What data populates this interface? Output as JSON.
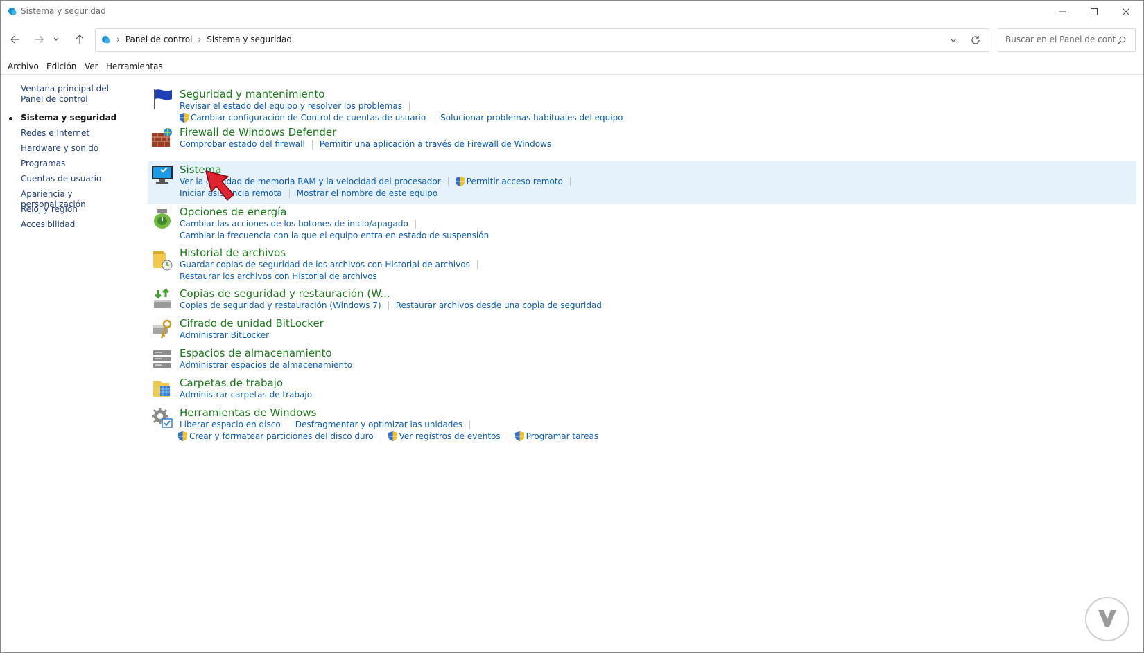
{
  "window": {
    "title": "Sistema y seguridad",
    "controls": [
      "minimize-icon",
      "maximize-icon",
      "close-icon"
    ]
  },
  "address_bar": {
    "breadcrumb": [
      "Panel de control",
      "Sistema y seguridad"
    ],
    "search_placeholder": "Buscar en el Panel de control"
  },
  "menu": [
    "Archivo",
    "Edición",
    "Ver",
    "Herramientas"
  ],
  "sidebar": {
    "items": [
      {
        "label": "Ventana principal del Panel de control",
        "active": false
      },
      {
        "label": "Sistema y seguridad",
        "active": true
      },
      {
        "label": "Redes e Internet",
        "active": false
      },
      {
        "label": "Hardware y sonido",
        "active": false
      },
      {
        "label": "Programas",
        "active": false
      },
      {
        "label": "Cuentas de usuario",
        "active": false
      },
      {
        "label": "Apariencia y personalización",
        "active": false
      },
      {
        "label": "Reloj y región",
        "active": false
      },
      {
        "label": "Accesibilidad",
        "active": false
      }
    ]
  },
  "categories": [
    {
      "title": "Seguridad y mantenimiento",
      "icon": "flag-icon",
      "rows": [
        [
          "Revisar el estado del equipo y resolver los problemas"
        ],
        [
          "Cambiar configuración de Control de cuentas de usuario",
          "Solucionar problemas habituales del equipo"
        ]
      ]
    },
    {
      "title": "Firewall de Windows Defender",
      "icon": "firewall-icon",
      "rows": [
        [
          "Comprobar estado del firewall",
          "Permitir una aplicación a través de Firewall de Windows"
        ]
      ]
    },
    {
      "title": "Sistema",
      "icon": "monitor-icon",
      "highlighted": true,
      "rows": [
        [
          "Ver la cantidad de memoria RAM y la velocidad del procesador",
          "Permitir acceso remoto"
        ],
        [
          "Iniciar asistencia remota",
          "Mostrar el nombre de este equipo"
        ]
      ]
    },
    {
      "title": "Opciones de energía",
      "icon": "battery-icon",
      "rows": [
        [
          "Cambiar las acciones de los botones de inicio/apagado"
        ],
        [
          "Cambiar la frecuencia con la que el equipo entra en estado de suspensión"
        ]
      ]
    },
    {
      "title": "Historial de archivos",
      "icon": "file-history-icon",
      "rows": [
        [
          "Guardar copias de seguridad de los archivos con Historial de archivos"
        ],
        [
          "Restaurar los archivos con Historial de archivos"
        ]
      ]
    },
    {
      "title": "Copias de seguridad y restauración (W...",
      "icon": "backup-icon",
      "rows": [
        [
          "Copias de seguridad y restauración (Windows 7)",
          "Restaurar archivos desde una copia de seguridad"
        ]
      ]
    },
    {
      "title": "Cifrado de unidad BitLocker",
      "icon": "bitlocker-icon",
      "rows": [
        [
          "Administrar BitLocker"
        ]
      ]
    },
    {
      "title": "Espacios de almacenamiento",
      "icon": "storage-icon",
      "rows": [
        [
          "Administrar espacios de almacenamiento"
        ]
      ]
    },
    {
      "title": "Carpetas de trabajo",
      "icon": "work-folders-icon",
      "rows": [
        [
          "Administrar carpetas de trabajo"
        ]
      ]
    },
    {
      "title": "Herramientas de Windows",
      "icon": "tools-icon",
      "rows": [
        [
          "Liberar espacio en disco",
          "Desfragmentar y optimizar las unidades"
        ],
        [
          "Crear y formatear particiones del disco duro",
          "Ver registros de eventos",
          "Programar tareas"
        ]
      ]
    }
  ],
  "shielded_links": [
    "Cambiar configuración de Control de cuentas de usuario",
    "Permitir acceso remoto",
    "Crear y formatear particiones del disco duro",
    "Ver registros de eventos",
    "Programar tareas"
  ],
  "colors": {
    "link": "#0a5db5",
    "category_title": "#1a7a1a",
    "highlight": "#e5f1fb",
    "cursor": "#e0232e"
  }
}
